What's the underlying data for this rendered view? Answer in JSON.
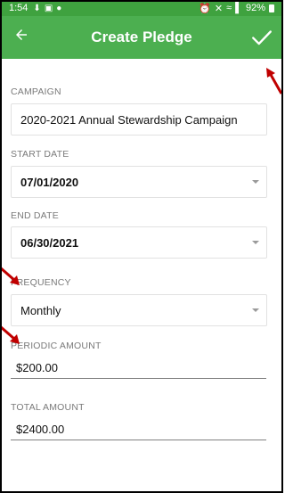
{
  "status_bar": {
    "time": "1:54",
    "battery": "92%",
    "icons_left": [
      "download-icon",
      "image-icon",
      "location-icon"
    ],
    "icons_right": [
      "alarm-icon",
      "mute-icon",
      "wifi-icon",
      "signal-icon",
      "battery-icon"
    ]
  },
  "app_bar": {
    "title": "Create Pledge",
    "back_icon": "arrow-back-icon",
    "confirm_icon": "check-icon",
    "background": "#4caf50"
  },
  "form": {
    "campaign": {
      "label": "CAMPAIGN",
      "value": "2020-2021 Annual Stewardship Campaign"
    },
    "start_date": {
      "label": "START DATE",
      "value": "07/01/2020"
    },
    "end_date": {
      "label": "END DATE",
      "value": "06/30/2021"
    },
    "frequency": {
      "label": "FREQUENCY",
      "value": "Monthly"
    },
    "periodic_amount": {
      "label": "PERIODIC AMOUNT",
      "value": "$200.00"
    },
    "total_amount": {
      "label": "TOTAL AMOUNT",
      "value": "$2400.00"
    }
  },
  "annotation_color": "#c00000"
}
